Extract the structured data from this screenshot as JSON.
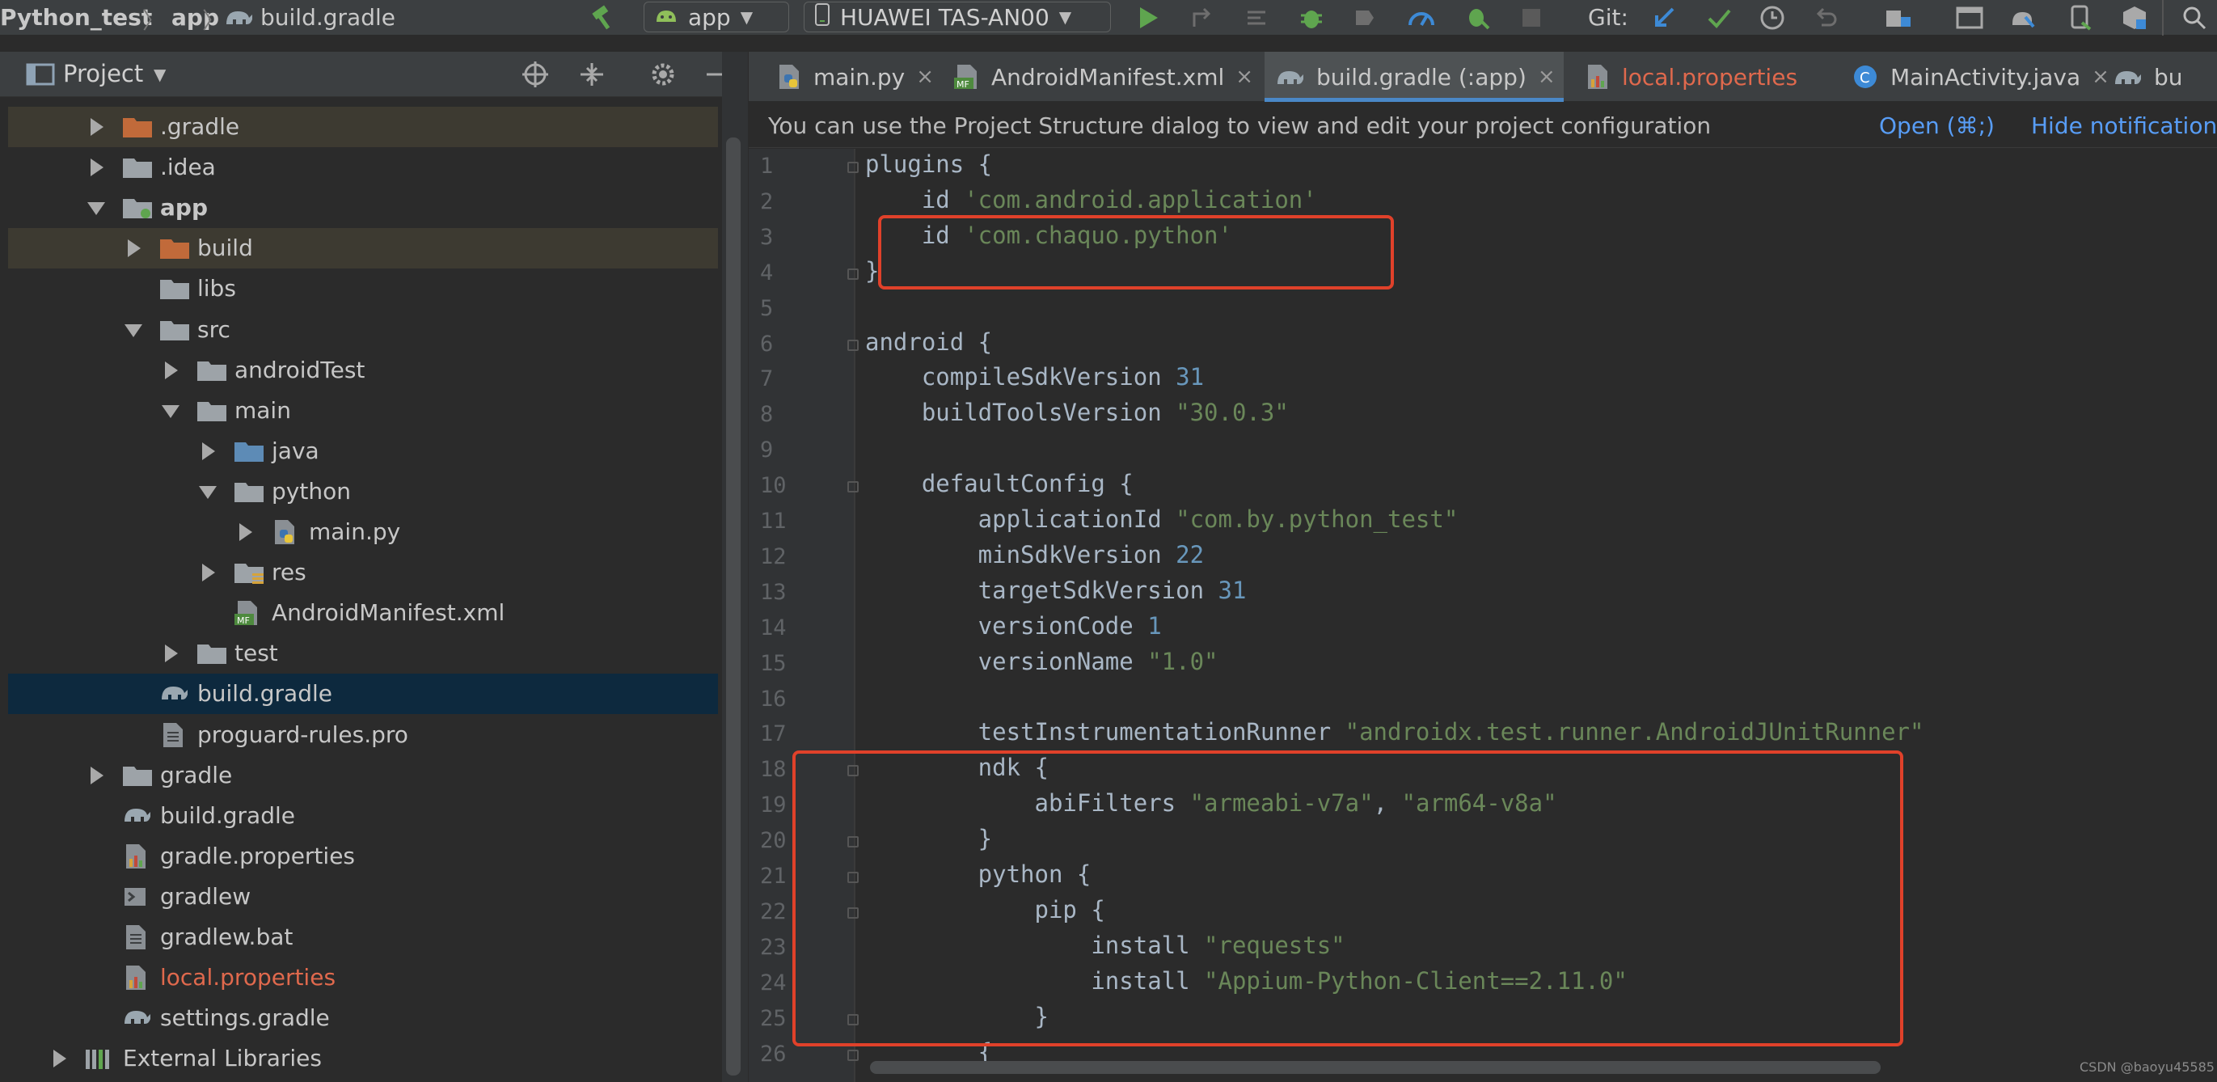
{
  "toolbar": {
    "breadcrumbs": [
      "Python_test",
      "app",
      "build.gradle"
    ],
    "run_config": "app",
    "device": "HUAWEI TAS-AN00",
    "git_label": "Git:"
  },
  "project_panel": {
    "title": "Project",
    "items": [
      {
        "label": ".gradle",
        "depth": 1,
        "arrow": "right",
        "icon": "folder-orange",
        "state": "highlight"
      },
      {
        "label": ".idea",
        "depth": 1,
        "arrow": "right",
        "icon": "folder",
        "state": ""
      },
      {
        "label": "app",
        "depth": 1,
        "arrow": "down",
        "icon": "module-folder",
        "state": "",
        "bold": true
      },
      {
        "label": "build",
        "depth": 2,
        "arrow": "right",
        "icon": "folder-orange",
        "state": "highlight"
      },
      {
        "label": "libs",
        "depth": 2,
        "arrow": "",
        "icon": "folder",
        "state": ""
      },
      {
        "label": "src",
        "depth": 2,
        "arrow": "down",
        "icon": "folder",
        "state": ""
      },
      {
        "label": "androidTest",
        "depth": 3,
        "arrow": "right",
        "icon": "folder",
        "state": ""
      },
      {
        "label": "main",
        "depth": 3,
        "arrow": "down",
        "icon": "folder",
        "state": ""
      },
      {
        "label": "java",
        "depth": 4,
        "arrow": "right",
        "icon": "folder-blue",
        "state": ""
      },
      {
        "label": "python",
        "depth": 4,
        "arrow": "down",
        "icon": "folder",
        "state": ""
      },
      {
        "label": "main.py",
        "depth": 5,
        "arrow": "right",
        "icon": "python-file",
        "state": ""
      },
      {
        "label": "res",
        "depth": 4,
        "arrow": "right",
        "icon": "res-folder",
        "state": ""
      },
      {
        "label": "AndroidManifest.xml",
        "depth": 4,
        "arrow": "",
        "icon": "manifest-file",
        "state": ""
      },
      {
        "label": "test",
        "depth": 3,
        "arrow": "right",
        "icon": "folder",
        "state": ""
      },
      {
        "label": "build.gradle",
        "depth": 2,
        "arrow": "",
        "icon": "gradle-file",
        "state": "selected"
      },
      {
        "label": "proguard-rules.pro",
        "depth": 2,
        "arrow": "",
        "icon": "text-file",
        "state": ""
      },
      {
        "label": "gradle",
        "depth": 1,
        "arrow": "right",
        "icon": "folder",
        "state": ""
      },
      {
        "label": "build.gradle",
        "depth": 1,
        "arrow": "",
        "icon": "gradle-file",
        "state": ""
      },
      {
        "label": "gradle.properties",
        "depth": 1,
        "arrow": "",
        "icon": "properties-file",
        "state": ""
      },
      {
        "label": "gradlew",
        "depth": 1,
        "arrow": "",
        "icon": "terminal-file",
        "state": ""
      },
      {
        "label": "gradlew.bat",
        "depth": 1,
        "arrow": "",
        "icon": "text-file",
        "state": ""
      },
      {
        "label": "local.properties",
        "depth": 1,
        "arrow": "",
        "icon": "properties-file",
        "state": "",
        "color": "#e0694d"
      },
      {
        "label": "settings.gradle",
        "depth": 1,
        "arrow": "",
        "icon": "gradle-file",
        "state": ""
      },
      {
        "label": "External Libraries",
        "depth": 0,
        "arrow": "right",
        "icon": "library",
        "state": ""
      }
    ]
  },
  "tabs": [
    {
      "label": "main.py",
      "icon": "python-file",
      "active": false,
      "color": "#c8c8c8",
      "close": true
    },
    {
      "label": "AndroidManifest.xml",
      "icon": "manifest-file",
      "active": false,
      "color": "#c8c8c8",
      "close": true
    },
    {
      "label": "build.gradle (:app)",
      "icon": "gradle-file",
      "active": true,
      "color": "#c8c8c8",
      "close": true
    },
    {
      "label": "local.properties",
      "icon": "properties-file",
      "active": false,
      "color": "#e0694d",
      "close": false
    },
    {
      "label": "MainActivity.java",
      "icon": "java-class",
      "active": false,
      "color": "#c8c8c8",
      "close": true
    },
    {
      "label": "bu",
      "icon": "gradle-file",
      "active": false,
      "color": "#c8c8c8",
      "close": false
    }
  ],
  "notification": {
    "message": "You can use the Project Structure dialog to view and edit your project configuration",
    "open_link": "Open (⌘;)",
    "hide_link": "Hide notification"
  },
  "editor": {
    "lines": [
      [
        [
          "id",
          "plugins {"
        ]
      ],
      [
        [
          "id",
          "    id "
        ],
        [
          "str",
          "'com.android.application'"
        ]
      ],
      [
        [
          "id",
          "    id "
        ],
        [
          "str",
          "'com.chaquo.python'"
        ]
      ],
      [
        [
          "id",
          "}"
        ]
      ],
      [
        [
          "id",
          ""
        ]
      ],
      [
        [
          "id",
          "android {"
        ]
      ],
      [
        [
          "id",
          "    compileSdkVersion "
        ],
        [
          "num",
          "31"
        ]
      ],
      [
        [
          "id",
          "    buildToolsVersion "
        ],
        [
          "str",
          "\"30.0.3\""
        ]
      ],
      [
        [
          "id",
          ""
        ]
      ],
      [
        [
          "id",
          "    defaultConfig {"
        ]
      ],
      [
        [
          "id",
          "        applicationId "
        ],
        [
          "str",
          "\"com.by.python_test\""
        ]
      ],
      [
        [
          "id",
          "        minSdkVersion "
        ],
        [
          "num",
          "22"
        ]
      ],
      [
        [
          "id",
          "        targetSdkVersion "
        ],
        [
          "num",
          "31"
        ]
      ],
      [
        [
          "id",
          "        versionCode "
        ],
        [
          "num",
          "1"
        ]
      ],
      [
        [
          "id",
          "        versionName "
        ],
        [
          "str",
          "\"1.0\""
        ]
      ],
      [
        [
          "id",
          ""
        ]
      ],
      [
        [
          "id",
          "        testInstrumentationRunner "
        ],
        [
          "str",
          "\"androidx.test.runner.AndroidJUnitRunner\""
        ]
      ],
      [
        [
          "id",
          "        ndk {"
        ]
      ],
      [
        [
          "id",
          "            abiFilters "
        ],
        [
          "str",
          "\"armeabi-v7a\""
        ],
        [
          "id",
          ", "
        ],
        [
          "str",
          "\"arm64-v8a\""
        ]
      ],
      [
        [
          "id",
          "        }"
        ]
      ],
      [
        [
          "id",
          "        python {"
        ]
      ],
      [
        [
          "id",
          "            pip {"
        ]
      ],
      [
        [
          "id",
          "                install "
        ],
        [
          "str",
          "\"requests\""
        ]
      ],
      [
        [
          "id",
          "                install "
        ],
        [
          "str",
          "\"Appium-Python-Client==2.11.0\""
        ]
      ],
      [
        [
          "id",
          "            }"
        ]
      ],
      [
        [
          "id",
          "        {"
        ]
      ]
    ]
  },
  "watermark": "CSDN @baoyu45585"
}
